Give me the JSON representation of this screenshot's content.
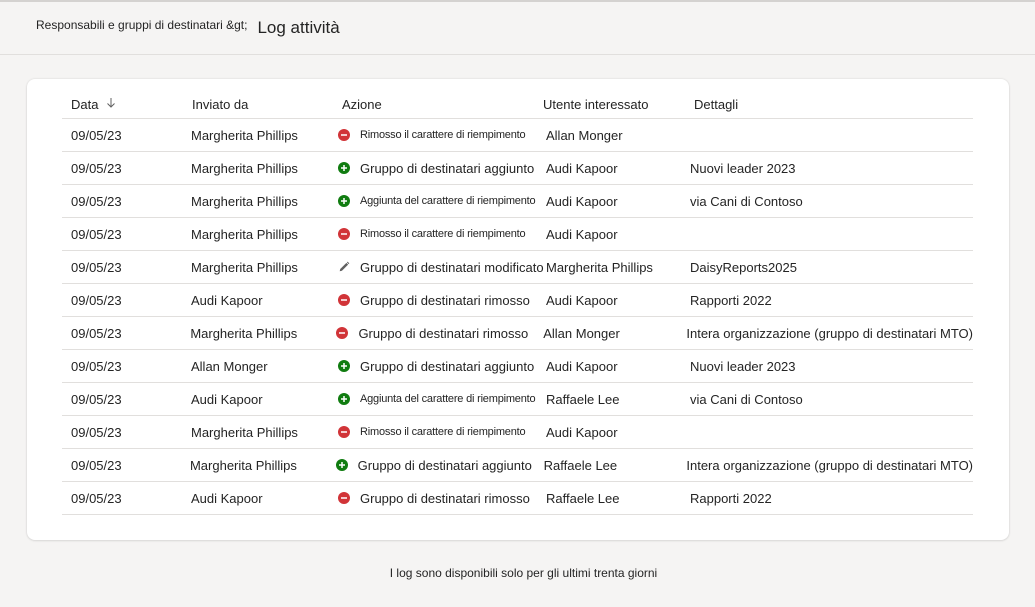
{
  "breadcrumb": {
    "parent": "Responsabili e gruppi di destinatari &gt;",
    "current": "Log attività"
  },
  "colors": {
    "remove": "#d13438",
    "add": "#107c10",
    "edit": "#616161"
  },
  "table": {
    "columns": {
      "date": "Data",
      "sent_by": "Inviato da",
      "action": "Azione",
      "user": "Utente interessato",
      "details": "Dettagli"
    },
    "sort_icon": "arrow-down-icon",
    "rows": [
      {
        "date": "09/05/23",
        "sent_by": "Margherita Phillips",
        "action": "Rimosso il carattere di riempimento",
        "icon": "remove-circle-icon",
        "user": "Allan Monger",
        "details": ""
      },
      {
        "date": "09/05/23",
        "sent_by": "Margherita Phillips",
        "action": "Gruppo di destinatari aggiunto",
        "icon": "add-circle-icon",
        "user": "Audi Kapoor",
        "details": "Nuovi leader 2023"
      },
      {
        "date": "09/05/23",
        "sent_by": "Margherita Phillips",
        "action": "Aggiunta del carattere di riempimento",
        "icon": "add-circle-icon",
        "user": "Audi Kapoor",
        "details": "via Cani di Contoso"
      },
      {
        "date": "09/05/23",
        "sent_by": "Margherita Phillips",
        "action": "Rimosso il carattere di riempimento",
        "icon": "remove-circle-icon",
        "user": "Audi Kapoor",
        "details": ""
      },
      {
        "date": "09/05/23",
        "sent_by": "Margherita Phillips",
        "action": "Gruppo di destinatari modificato",
        "icon": "edit-pencil-icon",
        "user": "Margherita Phillips",
        "details": "DaisyReports2025"
      },
      {
        "date": "09/05/23",
        "sent_by": "Audi Kapoor",
        "action": "Gruppo di destinatari rimosso",
        "icon": "remove-circle-icon",
        "user": "Audi Kapoor",
        "details": "Rapporti 2022"
      },
      {
        "date": "09/05/23",
        "sent_by": "Margherita Phillips",
        "action": "Gruppo di destinatari rimosso",
        "icon": "remove-circle-icon",
        "user": "Allan Monger",
        "details": "Intera organizzazione (gruppo di destinatari MTO)"
      },
      {
        "date": "09/05/23",
        "sent_by": "Allan Monger",
        "action": "Gruppo di destinatari aggiunto",
        "icon": "add-circle-icon",
        "user": "Audi Kapoor",
        "details": "Nuovi leader 2023"
      },
      {
        "date": "09/05/23",
        "sent_by": "Audi Kapoor",
        "action": "Aggiunta del carattere di riempimento",
        "icon": "add-circle-icon",
        "user": "Raffaele Lee",
        "details": "via Cani di Contoso"
      },
      {
        "date": "09/05/23",
        "sent_by": "Margherita Phillips",
        "action": "Rimosso il carattere di riempimento",
        "icon": "remove-circle-icon",
        "user": "Audi Kapoor",
        "details": ""
      },
      {
        "date": "09/05/23",
        "sent_by": "Margherita Phillips",
        "action": "Gruppo di destinatari aggiunto",
        "icon": "add-circle-icon",
        "user": "Raffaele Lee",
        "details": "Intera organizzazione (gruppo di destinatari MTO)"
      },
      {
        "date": "09/05/23",
        "sent_by": "Audi Kapoor",
        "action": "Gruppo di destinatari rimosso",
        "icon": "remove-circle-icon",
        "user": "Raffaele Lee",
        "details": "Rapporti 2022"
      }
    ]
  },
  "footer": {
    "note": "I log sono disponibili solo per gli ultimi trenta giorni"
  }
}
